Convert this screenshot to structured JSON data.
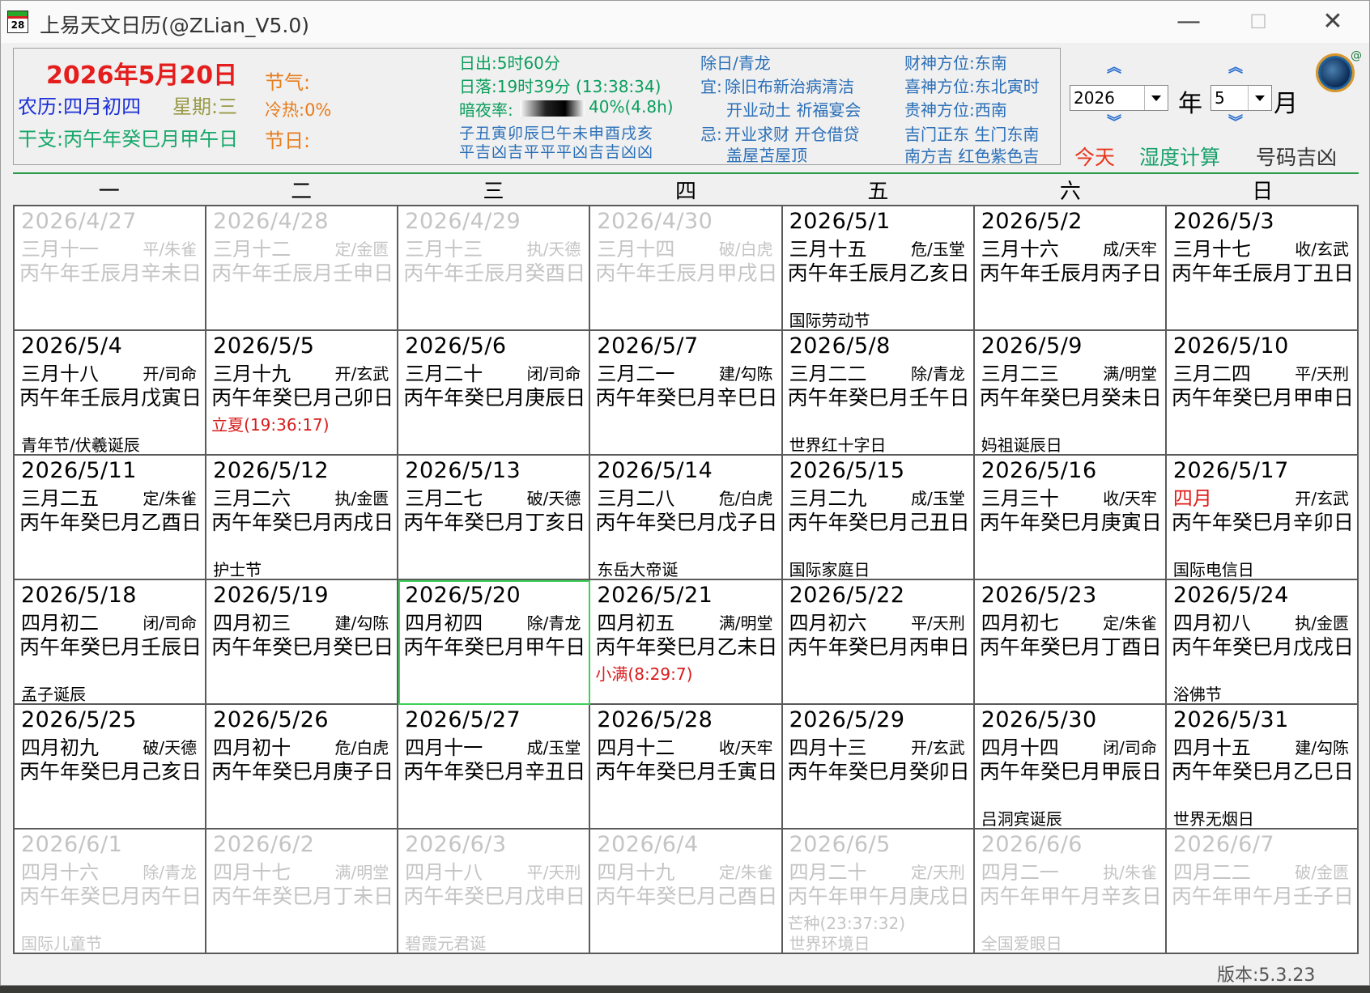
{
  "window": {
    "icon_text": "28",
    "title": "上易天文日历(@ZLian_V5.0)",
    "minimize": "—",
    "maximize": "☐",
    "close": "✕"
  },
  "info": {
    "solar_date": "2026年5月20日",
    "lunar": "农历:四月初四",
    "weekday": "星期:三",
    "ganzhi": "干支:丙午年癸巳月甲午日",
    "jieqi": "节气:",
    "lengre": "冷热:0%",
    "jieri": "节日:",
    "sunrise": "日出:5时60分",
    "sunset": "日落:19时39分 (13:38:34)",
    "night_ratio_label": "暗夜率:",
    "night_ratio_value": "40%(4.8h)",
    "night_ratio_fraction": 0.4,
    "hours_row1": "子丑寅卯辰巳午未申酉戌亥",
    "hours_row2": "平吉凶吉平平平凶吉吉凶凶",
    "day_god": "除日/青龙",
    "yi_label": "宜:",
    "yi_1": "除旧布新治病清洁",
    "yi_2": "开业动土 祈福宴会",
    "ji_label": "忌:",
    "ji_1": "开业求财 开仓借贷",
    "ji_2": "盖屋苫屋顶",
    "caishen": "财神方位:东南",
    "xishen": "喜神方位:东北寅时",
    "guishen": "贵神方位:西南",
    "gates": "吉门正东 生门东南",
    "directions": "南方吉 红色紫色吉"
  },
  "controls": {
    "year": "2026",
    "year_unit": "年",
    "month": "5",
    "month_unit": "月",
    "up": "︽",
    "down": "︾",
    "today": "今天",
    "humidity": "湿度计算",
    "number": "号码吉凶",
    "avatar_at": "@"
  },
  "weekdays": [
    "一",
    "二",
    "三",
    "四",
    "五",
    "六",
    "日"
  ],
  "colors": {
    "today_border": "#3ccf5a",
    "solar_term": "#d81b1b",
    "dim_text": "#c4c4c4",
    "date_red": "#e41d1d"
  },
  "days": [
    {
      "date": "2026/4/27",
      "lunar": "三月十一",
      "officer": "平/朱雀",
      "ganzhi": "丙午年壬辰月辛未日",
      "festival": "",
      "term": "",
      "dim": true
    },
    {
      "date": "2026/4/28",
      "lunar": "三月十二",
      "officer": "定/金匮",
      "ganzhi": "丙午年壬辰月壬申日",
      "festival": "",
      "term": "",
      "dim": true
    },
    {
      "date": "2026/4/29",
      "lunar": "三月十三",
      "officer": "执/天德",
      "ganzhi": "丙午年壬辰月癸酉日",
      "festival": "",
      "term": "",
      "dim": true
    },
    {
      "date": "2026/4/30",
      "lunar": "三月十四",
      "officer": "破/白虎",
      "ganzhi": "丙午年壬辰月甲戌日",
      "festival": "",
      "term": "",
      "dim": true
    },
    {
      "date": "2026/5/1",
      "lunar": "三月十五",
      "officer": "危/玉堂",
      "ganzhi": "丙午年壬辰月乙亥日",
      "festival": "国际劳动节",
      "term": ""
    },
    {
      "date": "2026/5/2",
      "lunar": "三月十六",
      "officer": "成/天牢",
      "ganzhi": "丙午年壬辰月丙子日",
      "festival": "",
      "term": ""
    },
    {
      "date": "2026/5/3",
      "lunar": "三月十七",
      "officer": "收/玄武",
      "ganzhi": "丙午年壬辰月丁丑日",
      "festival": "",
      "term": ""
    },
    {
      "date": "2026/5/4",
      "lunar": "三月十八",
      "officer": "开/司命",
      "ganzhi": "丙午年壬辰月戊寅日",
      "festival": "青年节/伏羲诞辰",
      "term": ""
    },
    {
      "date": "2026/5/5",
      "lunar": "三月十九",
      "officer": "开/玄武",
      "ganzhi": "丙午年癸巳月己卯日",
      "festival": "",
      "term": "立夏(19:36:17)"
    },
    {
      "date": "2026/5/6",
      "lunar": "三月二十",
      "officer": "闭/司命",
      "ganzhi": "丙午年癸巳月庚辰日",
      "festival": "",
      "term": ""
    },
    {
      "date": "2026/5/7",
      "lunar": "三月二一",
      "officer": "建/勾陈",
      "ganzhi": "丙午年癸巳月辛巳日",
      "festival": "",
      "term": ""
    },
    {
      "date": "2026/5/8",
      "lunar": "三月二二",
      "officer": "除/青龙",
      "ganzhi": "丙午年癸巳月壬午日",
      "festival": "世界红十字日",
      "term": ""
    },
    {
      "date": "2026/5/9",
      "lunar": "三月二三",
      "officer": "满/明堂",
      "ganzhi": "丙午年癸巳月癸未日",
      "festival": "妈祖诞辰日",
      "term": ""
    },
    {
      "date": "2026/5/10",
      "lunar": "三月二四",
      "officer": "平/天刑",
      "ganzhi": "丙午年癸巳月甲申日",
      "festival": "",
      "term": ""
    },
    {
      "date": "2026/5/11",
      "lunar": "三月二五",
      "officer": "定/朱雀",
      "ganzhi": "丙午年癸巳月乙酉日",
      "festival": "",
      "term": ""
    },
    {
      "date": "2026/5/12",
      "lunar": "三月二六",
      "officer": "执/金匮",
      "ganzhi": "丙午年癸巳月丙戌日",
      "festival": "护士节",
      "term": ""
    },
    {
      "date": "2026/5/13",
      "lunar": "三月二七",
      "officer": "破/天德",
      "ganzhi": "丙午年癸巳月丁亥日",
      "festival": "",
      "term": ""
    },
    {
      "date": "2026/5/14",
      "lunar": "三月二八",
      "officer": "危/白虎",
      "ganzhi": "丙午年癸巳月戊子日",
      "festival": "东岳大帝诞",
      "term": ""
    },
    {
      "date": "2026/5/15",
      "lunar": "三月二九",
      "officer": "成/玉堂",
      "ganzhi": "丙午年癸巳月己丑日",
      "festival": "国际家庭日",
      "term": ""
    },
    {
      "date": "2026/5/16",
      "lunar": "三月三十",
      "officer": "收/天牢",
      "ganzhi": "丙午年癸巳月庚寅日",
      "festival": "",
      "term": ""
    },
    {
      "date": "2026/5/17",
      "lunar": "四月",
      "officer": "开/玄武",
      "ganzhi": "丙午年癸巳月辛卯日",
      "festival": "国际电信日",
      "term": "",
      "lunar_red": true
    },
    {
      "date": "2026/5/18",
      "lunar": "四月初二",
      "officer": "闭/司命",
      "ganzhi": "丙午年癸巳月壬辰日",
      "festival": "孟子诞辰",
      "term": ""
    },
    {
      "date": "2026/5/19",
      "lunar": "四月初三",
      "officer": "建/勾陈",
      "ganzhi": "丙午年癸巳月癸巳日",
      "festival": "",
      "term": ""
    },
    {
      "date": "2026/5/20",
      "lunar": "四月初四",
      "officer": "除/青龙",
      "ganzhi": "丙午年癸巳月甲午日",
      "festival": "",
      "term": "",
      "today": true
    },
    {
      "date": "2026/5/21",
      "lunar": "四月初五",
      "officer": "满/明堂",
      "ganzhi": "丙午年癸巳月乙未日",
      "festival": "",
      "term": "小满(8:29:7)"
    },
    {
      "date": "2026/5/22",
      "lunar": "四月初六",
      "officer": "平/天刑",
      "ganzhi": "丙午年癸巳月丙申日",
      "festival": "",
      "term": ""
    },
    {
      "date": "2026/5/23",
      "lunar": "四月初七",
      "officer": "定/朱雀",
      "ganzhi": "丙午年癸巳月丁酉日",
      "festival": "",
      "term": ""
    },
    {
      "date": "2026/5/24",
      "lunar": "四月初八",
      "officer": "执/金匮",
      "ganzhi": "丙午年癸巳月戊戌日",
      "festival": "浴佛节",
      "term": ""
    },
    {
      "date": "2026/5/25",
      "lunar": "四月初九",
      "officer": "破/天德",
      "ganzhi": "丙午年癸巳月己亥日",
      "festival": "",
      "term": ""
    },
    {
      "date": "2026/5/26",
      "lunar": "四月初十",
      "officer": "危/白虎",
      "ganzhi": "丙午年癸巳月庚子日",
      "festival": "",
      "term": ""
    },
    {
      "date": "2026/5/27",
      "lunar": "四月十一",
      "officer": "成/玉堂",
      "ganzhi": "丙午年癸巳月辛丑日",
      "festival": "",
      "term": ""
    },
    {
      "date": "2026/5/28",
      "lunar": "四月十二",
      "officer": "收/天牢",
      "ganzhi": "丙午年癸巳月壬寅日",
      "festival": "",
      "term": ""
    },
    {
      "date": "2026/5/29",
      "lunar": "四月十三",
      "officer": "开/玄武",
      "ganzhi": "丙午年癸巳月癸卯日",
      "festival": "",
      "term": ""
    },
    {
      "date": "2026/5/30",
      "lunar": "四月十四",
      "officer": "闭/司命",
      "ganzhi": "丙午年癸巳月甲辰日",
      "festival": "吕洞宾诞辰",
      "term": ""
    },
    {
      "date": "2026/5/31",
      "lunar": "四月十五",
      "officer": "建/勾陈",
      "ganzhi": "丙午年癸巳月乙巳日",
      "festival": "世界无烟日",
      "term": ""
    },
    {
      "date": "2026/6/1",
      "lunar": "四月十六",
      "officer": "除/青龙",
      "ganzhi": "丙午年癸巳月丙午日",
      "festival": "国际儿童节",
      "term": "",
      "dim": true
    },
    {
      "date": "2026/6/2",
      "lunar": "四月十七",
      "officer": "满/明堂",
      "ganzhi": "丙午年癸巳月丁未日",
      "festival": "",
      "term": "",
      "dim": true
    },
    {
      "date": "2026/6/3",
      "lunar": "四月十八",
      "officer": "平/天刑",
      "ganzhi": "丙午年癸巳月戊申日",
      "festival": "碧霞元君诞",
      "term": "",
      "dim": true
    },
    {
      "date": "2026/6/4",
      "lunar": "四月十九",
      "officer": "定/朱雀",
      "ganzhi": "丙午年癸巳月己酉日",
      "festival": "",
      "term": "",
      "dim": true
    },
    {
      "date": "2026/6/5",
      "lunar": "四月二十",
      "officer": "定/天刑",
      "ganzhi": "丙午年甲午月庚戌日",
      "festival": "世界环境日",
      "term": "芒种(23:37:32)",
      "dim": true
    },
    {
      "date": "2026/6/6",
      "lunar": "四月二一",
      "officer": "执/朱雀",
      "ganzhi": "丙午年甲午月辛亥日",
      "festival": "全国爱眼日",
      "term": "",
      "dim": true
    },
    {
      "date": "2026/6/7",
      "lunar": "四月二二",
      "officer": "破/金匮",
      "ganzhi": "丙午年甲午月壬子日",
      "festival": "",
      "term": "",
      "dim": true
    }
  ],
  "version": "版本:5.3.23"
}
